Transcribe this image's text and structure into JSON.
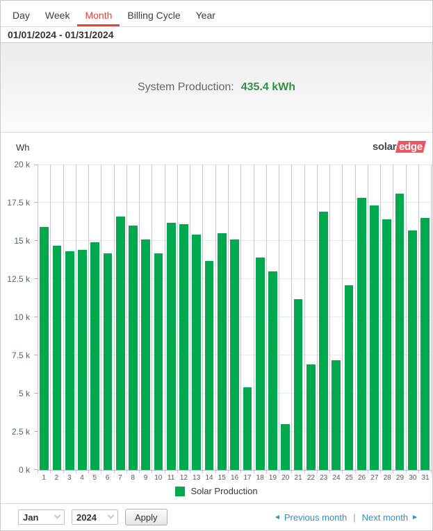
{
  "tabs": {
    "items": [
      {
        "label": "Day",
        "active": false
      },
      {
        "label": "Week",
        "active": false
      },
      {
        "label": "Month",
        "active": true
      },
      {
        "label": "Billing Cycle",
        "active": false
      },
      {
        "label": "Year",
        "active": false
      }
    ]
  },
  "date_range": "01/01/2024 - 01/31/2024",
  "summary": {
    "label": "System Production:",
    "value": "435.4 kWh"
  },
  "chart": {
    "unit_label": "Wh",
    "logo_solar": "solar",
    "logo_edge": "edge",
    "legend_label": "Solar Production"
  },
  "chart_data": {
    "type": "bar",
    "title": "",
    "xlabel": "",
    "ylabel": "Wh",
    "ylim": [
      0,
      20000
    ],
    "grid": true,
    "legend": [
      "Solar Production"
    ],
    "legend_position": "bottom",
    "bar_color": "#00a94e",
    "categories": [
      1,
      2,
      3,
      4,
      5,
      6,
      7,
      8,
      9,
      10,
      11,
      12,
      13,
      14,
      15,
      16,
      17,
      18,
      19,
      20,
      21,
      22,
      23,
      24,
      25,
      26,
      27,
      28,
      29,
      30,
      31
    ],
    "values": [
      15900,
      14700,
      14300,
      14400,
      14900,
      14200,
      16600,
      16000,
      15100,
      14200,
      16200,
      16100,
      15400,
      13700,
      15500,
      15100,
      5400,
      13900,
      13000,
      3000,
      11200,
      6900,
      16900,
      7200,
      12100,
      17800,
      17300,
      16400,
      18100,
      15700,
      16500
    ],
    "yticks": [
      {
        "label": "0 k",
        "value": 0
      },
      {
        "label": "2.5 k",
        "value": 2500
      },
      {
        "label": "5 k",
        "value": 5000
      },
      {
        "label": "7.5 k",
        "value": 7500
      },
      {
        "label": "10 k",
        "value": 10000
      },
      {
        "label": "12.5 k",
        "value": 12500
      },
      {
        "label": "15 k",
        "value": 15000
      },
      {
        "label": "17.5 k",
        "value": 17500
      },
      {
        "label": "20 k",
        "value": 20000
      }
    ]
  },
  "controls": {
    "month_value": "Jan",
    "year_value": "2024",
    "apply_label": "Apply",
    "prev_arrow": "◄",
    "prev_label": "Previous month",
    "separator": "|",
    "next_label": "Next month",
    "next_arrow": "►"
  },
  "colors": {
    "accent_red": "#f03b3b",
    "bar_green": "#00a94e",
    "value_green": "#2e9442",
    "link_blue": "#2b90c8",
    "logo_red": "#ef5662"
  }
}
